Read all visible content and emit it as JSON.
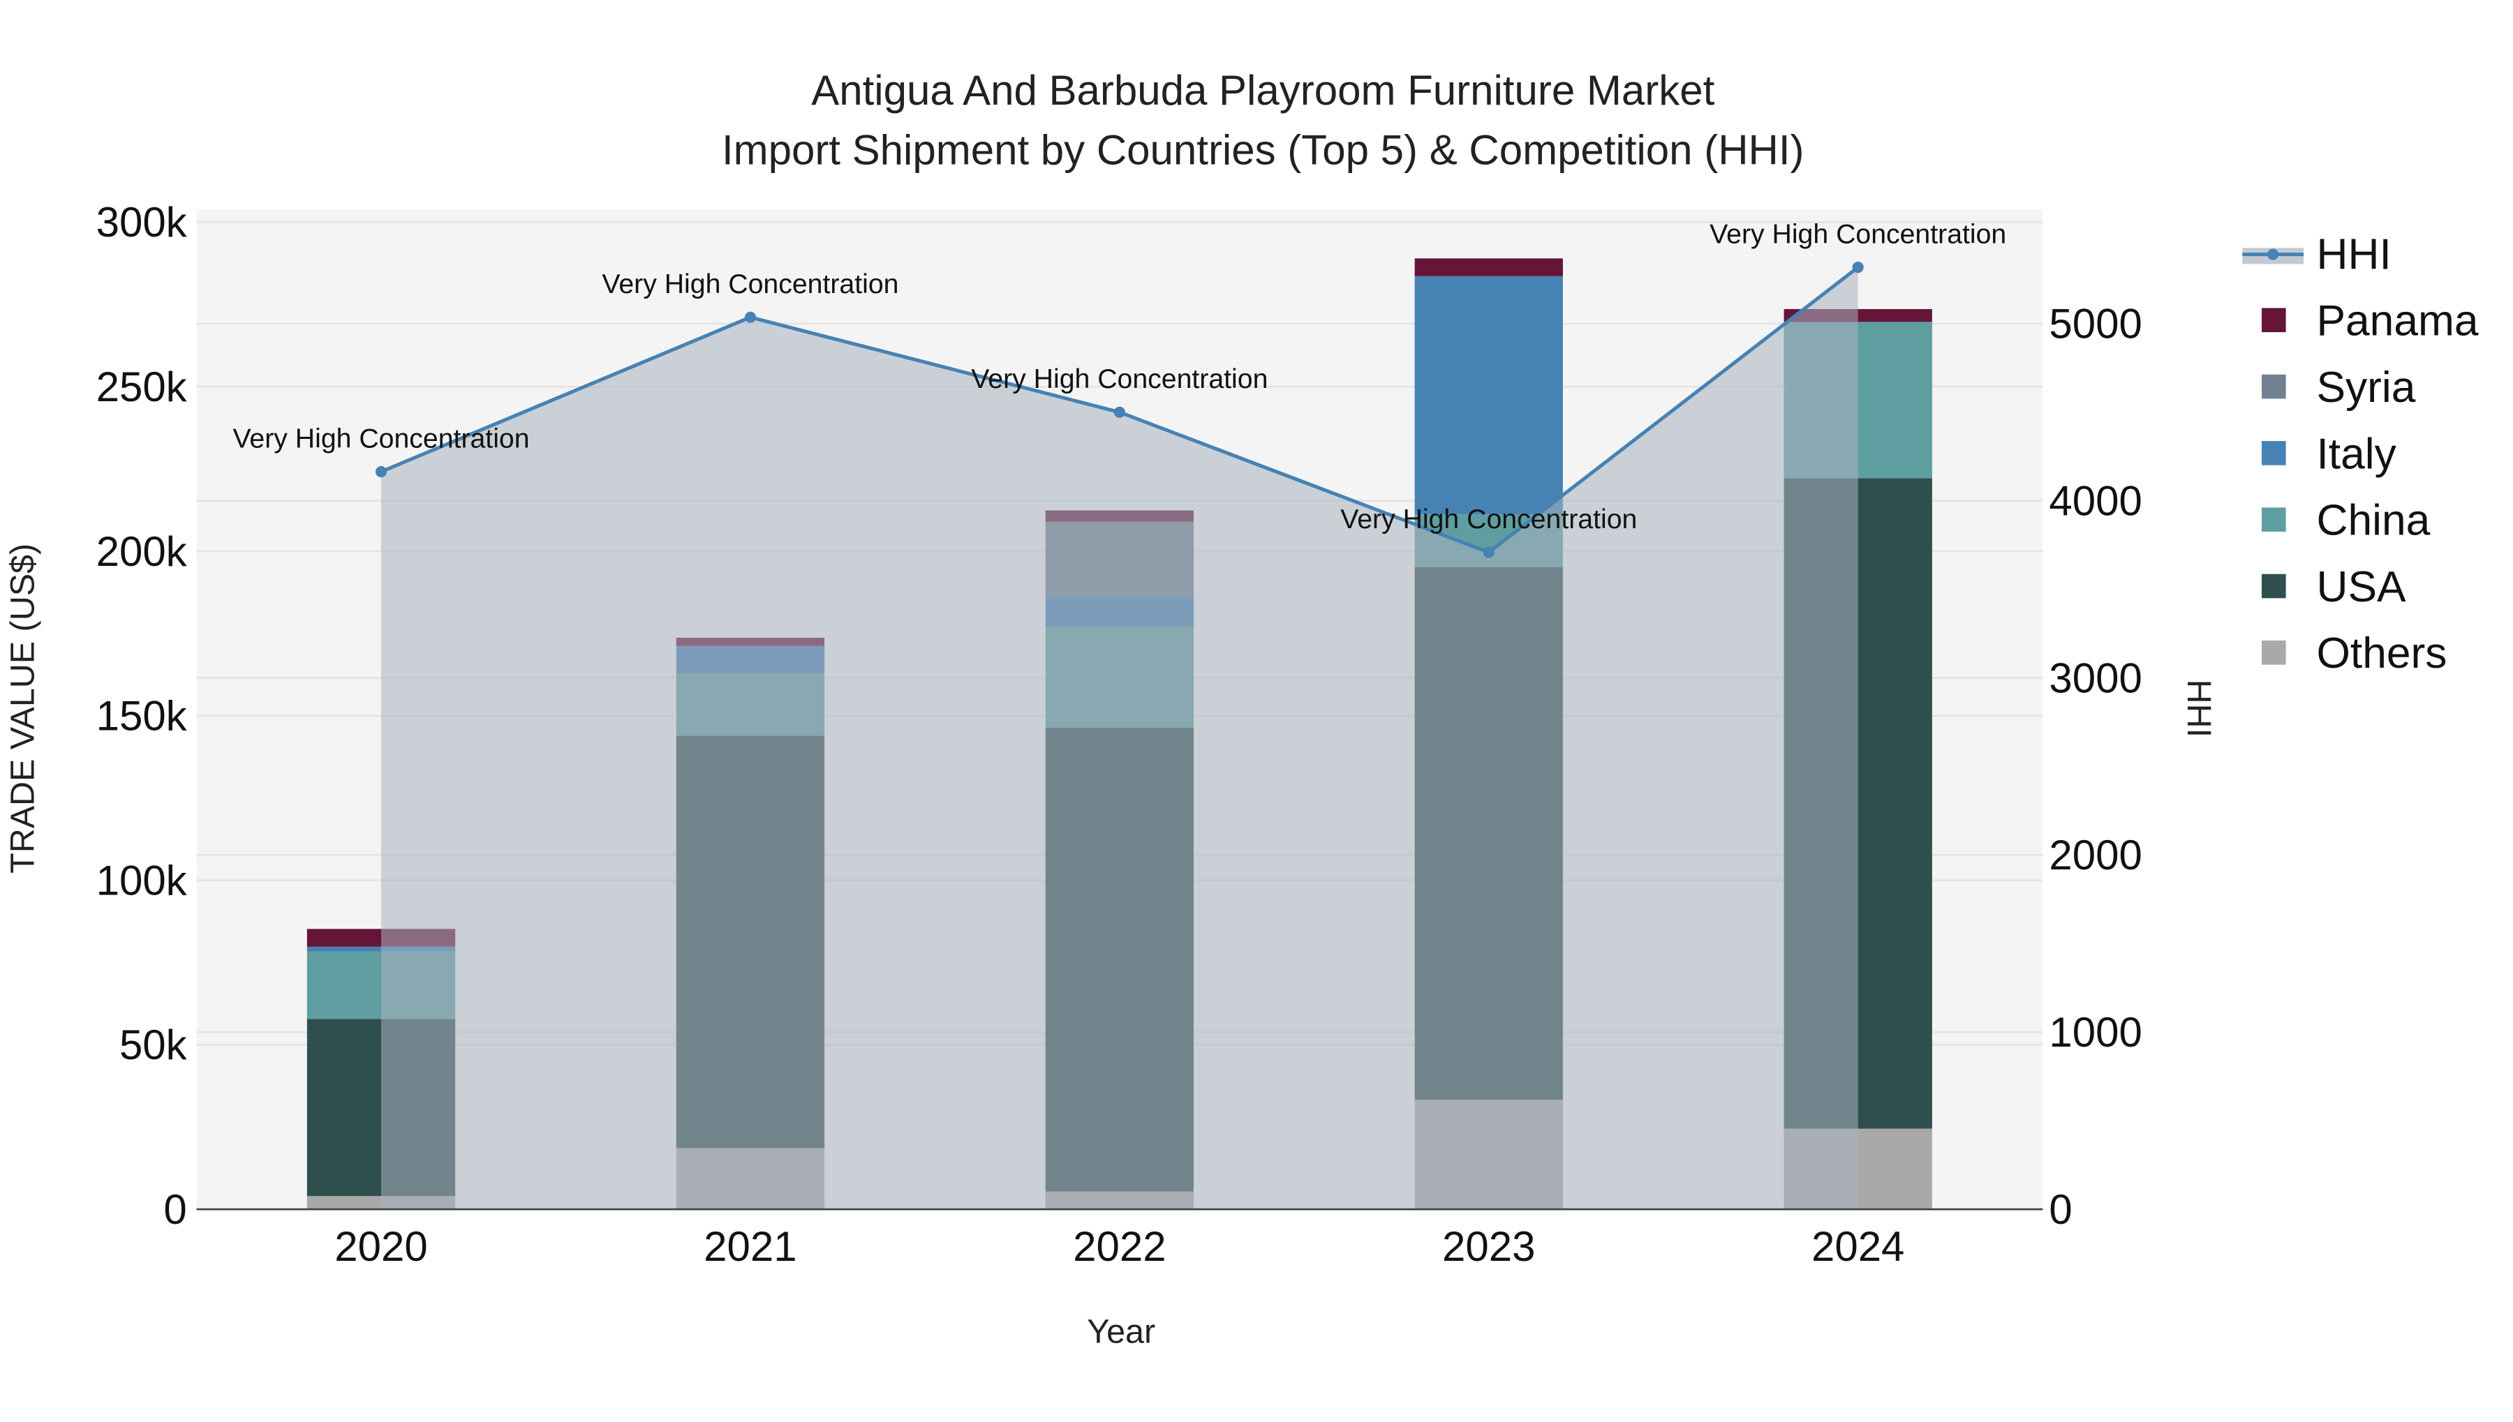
{
  "chart_data": {
    "type": "bar",
    "title_line1": "Antigua And Barbuda Playroom Furniture Market",
    "title_line2": "Import Shipment by Countries (Top 5) & Competition (HHI)",
    "xlabel": "Year",
    "ylabel": "TRADE VALUE (US$)",
    "y2label": "HHI",
    "categories": [
      "2020",
      "2021",
      "2022",
      "2023",
      "2024"
    ],
    "ylim": [
      0,
      300000
    ],
    "y2lim": [
      0,
      5500
    ],
    "yticks": [
      {
        "v": 0,
        "label": "0"
      },
      {
        "v": 50000,
        "label": "50k"
      },
      {
        "v": 100000,
        "label": "100k"
      },
      {
        "v": 150000,
        "label": "150k"
      },
      {
        "v": 200000,
        "label": "200k"
      },
      {
        "v": 250000,
        "label": "250k"
      },
      {
        "v": 300000,
        "label": "300k"
      }
    ],
    "y2ticks": [
      {
        "v": 0,
        "label": "0"
      },
      {
        "v": 1000,
        "label": "1000"
      },
      {
        "v": 2000,
        "label": "2000"
      },
      {
        "v": 3000,
        "label": "3000"
      },
      {
        "v": 4000,
        "label": "4000"
      },
      {
        "v": 5000,
        "label": "5000"
      }
    ],
    "series": [
      {
        "name": "Others",
        "color": "#a9a9a9",
        "values": [
          4000,
          18600,
          5400,
          33300,
          24500
        ]
      },
      {
        "name": "USA",
        "color": "#2f4f4f",
        "values": [
          53800,
          125300,
          141000,
          161900,
          197700
        ]
      },
      {
        "name": "China",
        "color": "#5f9ea0",
        "values": [
          20500,
          19000,
          30800,
          16000,
          47500
        ]
      },
      {
        "name": "Italy",
        "color": "#4682b4",
        "values": [
          1500,
          8300,
          8800,
          72400,
          0
        ]
      },
      {
        "name": "Syria",
        "color": "#708090",
        "values": [
          0,
          0,
          23000,
          0,
          0
        ]
      },
      {
        "name": "Panama",
        "color": "#641538",
        "values": [
          5400,
          2500,
          3400,
          5400,
          3900
        ]
      }
    ],
    "hhi": {
      "name": "HHI",
      "color": "#4682b4",
      "values": [
        4164,
        5036,
        4500,
        3709,
        5318
      ],
      "annotations": [
        "Very High Concentration",
        "Very High Concentration",
        "Very High Concentration",
        "Very High Concentration",
        "Very High Concentration"
      ]
    },
    "legend_order": [
      "HHI",
      "Panama",
      "Syria",
      "Italy",
      "China",
      "USA",
      "Others"
    ],
    "legend_position": "right",
    "grid": true
  }
}
